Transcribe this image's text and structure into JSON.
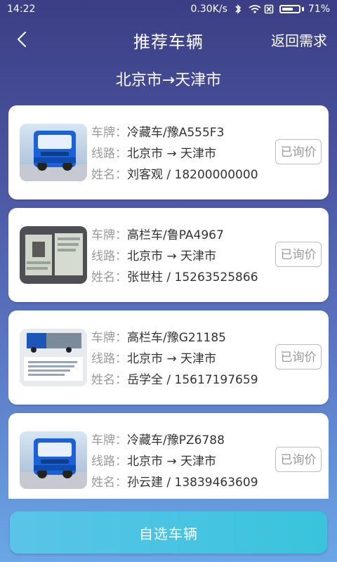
{
  "status": {
    "time": "14:22",
    "speed": "0.30K/s",
    "battery": "71%",
    "battery_level": 0.71,
    "icons": [
      "bluetooth-icon",
      "wifi-icon",
      "sim-icon",
      "battery-icon"
    ]
  },
  "nav": {
    "title": "推荐车辆",
    "back_icon": "chevron-left-icon",
    "right_link": "返回需求"
  },
  "route_title": "北京市→天津市",
  "labels": {
    "plate": "车牌：",
    "route": "线路：",
    "name": "姓名："
  },
  "vehicles": [
    {
      "plate": "冷藏车/豫A555F3",
      "route": "北京市 → 天津市",
      "contact": "刘客观 / 18200000000",
      "status": "已询价",
      "thumb": "blue-truck"
    },
    {
      "plate": "高栏车/鲁PA4967",
      "route": "北京市 → 天津市",
      "contact": "张世柱 / 15263525866",
      "status": "已询价",
      "thumb": "license"
    },
    {
      "plate": "高栏车/豫G21185",
      "route": "北京市 → 天津市",
      "contact": "岳学全 / 15617197659",
      "status": "已询价",
      "thumb": "cargo-truck"
    },
    {
      "plate": "冷藏车/豫PZ6788",
      "route": "北京市 → 天津市",
      "contact": "孙云建 / 13839463609",
      "status": "已询价",
      "thumb": "blue-truck"
    }
  ],
  "bottom_button": "自选车辆",
  "colors": {
    "accent": "#46C3E3",
    "header_bg": "#3B3E84",
    "card_bg": "#FFFFFF"
  }
}
